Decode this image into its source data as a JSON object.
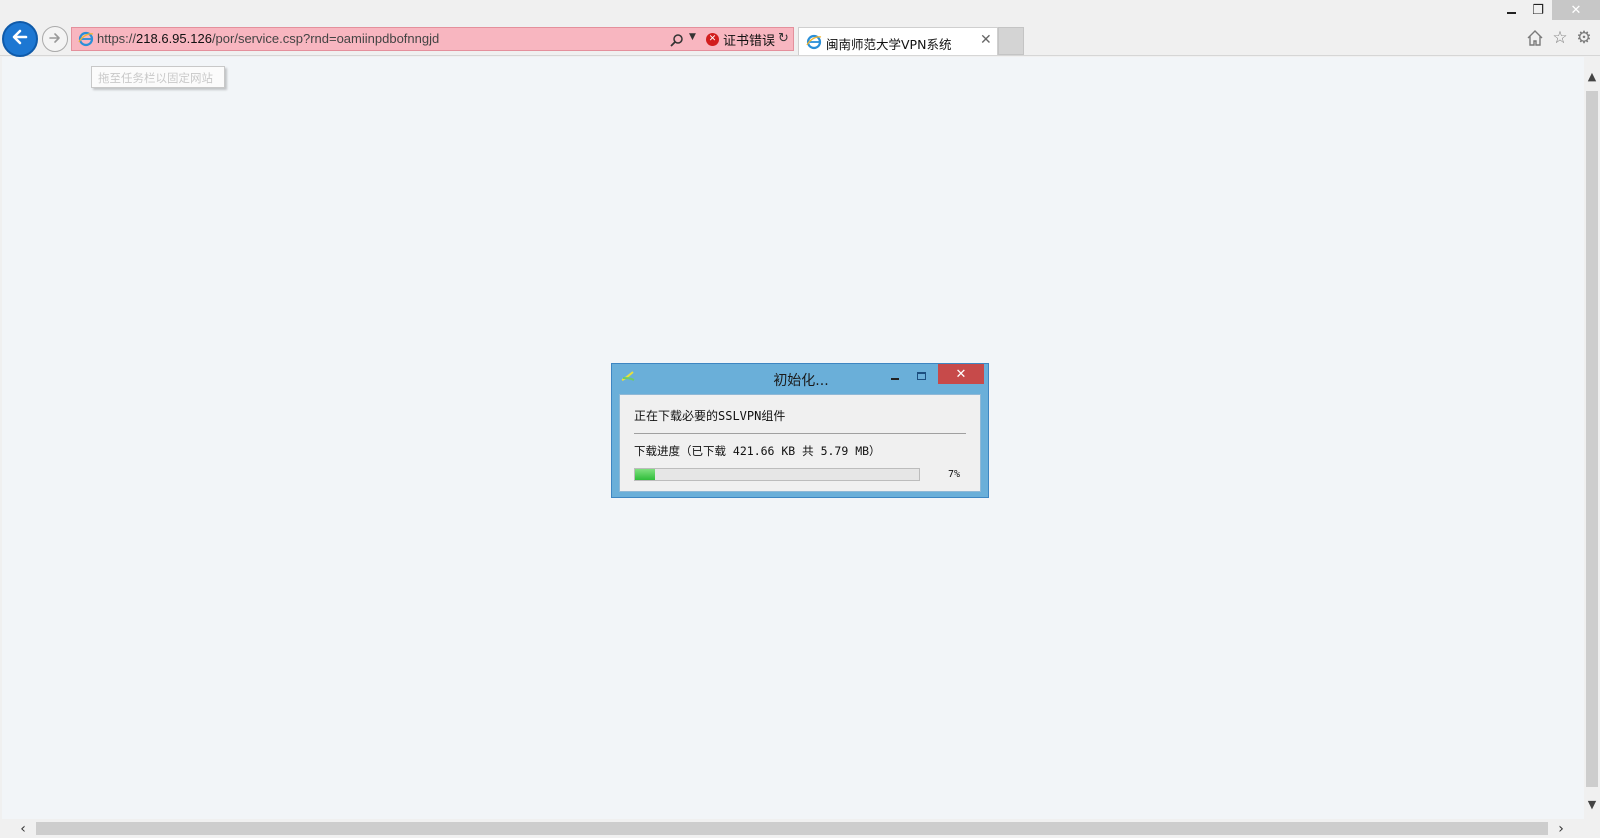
{
  "browser": {
    "address": {
      "url_prefix": "https://",
      "url_host": "218.6.95.126",
      "url_path": "/por/service.csp?rnd=oamiinpdbofnngjd",
      "cert_error_label": "证书错误"
    },
    "tab": {
      "title": "闽南师范大学VPN系统",
      "close_glyph": "✕"
    },
    "pin_tooltip": "拖至任务栏以固定网站",
    "window_controls": {
      "restore_glyph": "❐",
      "close_glyph": "✕"
    },
    "icons": [
      "back-arrow-icon",
      "forward-arrow-icon",
      "ie-logo-icon",
      "search-icon",
      "dropdown-icon",
      "cert-error-icon",
      "refresh-icon",
      "home-icon",
      "favorites-star-icon",
      "settings-gear-icon"
    ]
  },
  "dialog": {
    "title": "初始化...",
    "message": "正在下载必要的SSLVPN组件",
    "progress_label": "下载进度（已下载 421.66 KB 共 5.79 MB）",
    "progress_fraction": 0.07,
    "progress_text": "7%",
    "close_glyph": "✕"
  },
  "colors": {
    "address_bar_error": "#f8b6c0",
    "dialog_frame": "#6aafd9",
    "dialog_close": "#c74a4a",
    "progress_fill": "#2fbd3a",
    "back_button": "#1d77d2"
  }
}
